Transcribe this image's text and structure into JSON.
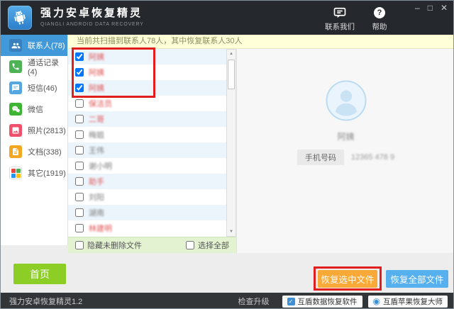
{
  "window": {
    "title": "强力安卓恢复精灵",
    "subtitle": "QIANGLI ANDROID DATA RECOVERY",
    "controls": {
      "minimize": "–",
      "maximize": "□",
      "close": "✕"
    }
  },
  "header": {
    "contact_us": "联系我们",
    "help": "帮助",
    "help_glyph": "?"
  },
  "sidebar": {
    "items": [
      {
        "label": "联系人(78)",
        "icon": "contacts-icon",
        "icon_bg": "#3a80bd",
        "selected": true
      },
      {
        "label": "通话记录(4)",
        "icon": "phone-icon",
        "icon_bg": "#4db356",
        "selected": false
      },
      {
        "label": "短信(46)",
        "icon": "message-icon",
        "icon_bg": "#56a7e0",
        "selected": false
      },
      {
        "label": "微信",
        "icon": "wechat-icon",
        "icon_bg": "#3eb434",
        "selected": false
      },
      {
        "label": "照片(2813)",
        "icon": "photo-icon",
        "icon_bg": "#f0506a",
        "selected": false
      },
      {
        "label": "文档(338)",
        "icon": "document-icon",
        "icon_bg": "#f5a623",
        "selected": false
      },
      {
        "label": "其它(1919)",
        "icon": "grid-icon",
        "icon_bg": "#ffffff",
        "selected": false
      }
    ],
    "home_button": "首页"
  },
  "notice": "当前共扫描到联系人78人，其中恢复联系人30人",
  "contact_list": {
    "items": [
      {
        "name": "阿姨",
        "checked": true,
        "red": true
      },
      {
        "name": "阿姨",
        "checked": true,
        "red": true
      },
      {
        "name": "阿姨",
        "checked": true,
        "red": true
      },
      {
        "name": "保洁员",
        "checked": false,
        "red": true
      },
      {
        "name": "二哥",
        "checked": false,
        "red": true
      },
      {
        "name": "梅姐",
        "checked": false,
        "red": false
      },
      {
        "name": "王伟",
        "checked": false,
        "red": false
      },
      {
        "name": "谢小明",
        "checked": false,
        "red": false
      },
      {
        "name": "助手",
        "checked": false,
        "red": true
      },
      {
        "name": "刘阳",
        "checked": false,
        "red": false
      },
      {
        "name": "湖南",
        "checked": false,
        "red": false
      },
      {
        "name": "林建明",
        "checked": false,
        "red": true
      }
    ],
    "hide_undeleted_label": "隐藏未删除文件",
    "select_all_label": "选择全部"
  },
  "detail": {
    "name": "阿姨",
    "phone_label": "手机号码",
    "phone_number": "12365 478 9"
  },
  "actions": {
    "recover_selected": "恢复选中文件",
    "recover_all": "恢复全部文件"
  },
  "statusbar": {
    "version": "强力安卓恢复精灵1.2",
    "check_upgrade": "检查升级",
    "promo1": "互盾数据恢复软件",
    "promo2": "互盾苹果恢复大师",
    "promo1_glyph": "✓",
    "promo2_glyph": "◉"
  },
  "colors": {
    "accent_blue": "#4199d9",
    "titlebar_bg": "#25282c",
    "statusbar_bg": "#323639",
    "notice_bg": "#ffffd8",
    "green_button": "#8ccd26",
    "orange_button": "#f9a937",
    "blue_button": "#57b0ee",
    "annotation_red": "#e11d1d",
    "list_alt_row": "#ecf5fc",
    "green_bar_bg": "#e3f3d2",
    "detail_bg": "#f7f7f7"
  }
}
